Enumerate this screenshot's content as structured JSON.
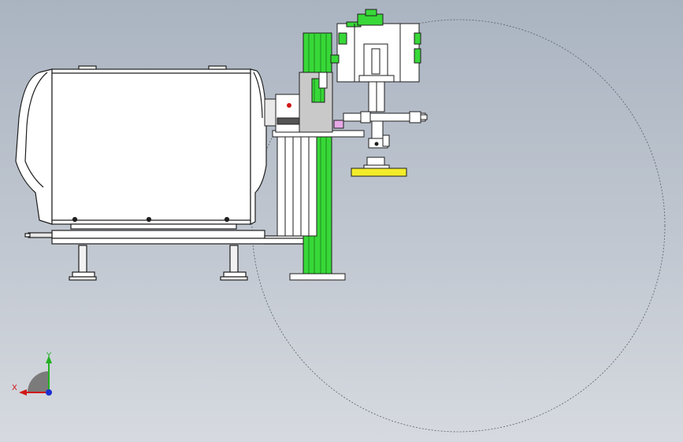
{
  "viewport": {
    "background_top": "#aab4c1",
    "background_bottom": "#d6dae0"
  },
  "triad": {
    "x_label": "X",
    "y_label": "Y",
    "x_color": "#d01818",
    "y_color": "#22b022",
    "z_color": "#1a2fd0"
  },
  "colors": {
    "body_white": "#ffffff",
    "outline": "#1e1e1e",
    "green_rail": "#38d838",
    "yellow_part": "#f3ec2a",
    "gray_bracket": "#c9c9c9",
    "pink_part": "#e7a8e6",
    "red_dot": "#d01818"
  }
}
